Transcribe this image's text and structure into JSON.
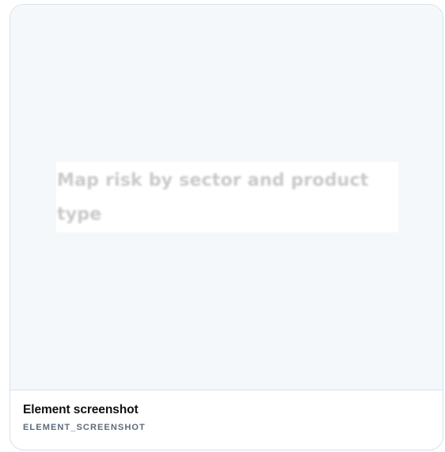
{
  "preview": {
    "snippet_text": "Map risk by sector and product type"
  },
  "footer": {
    "title": "Element screenshot",
    "code": "ELEMENT_SCREENSHOT"
  }
}
